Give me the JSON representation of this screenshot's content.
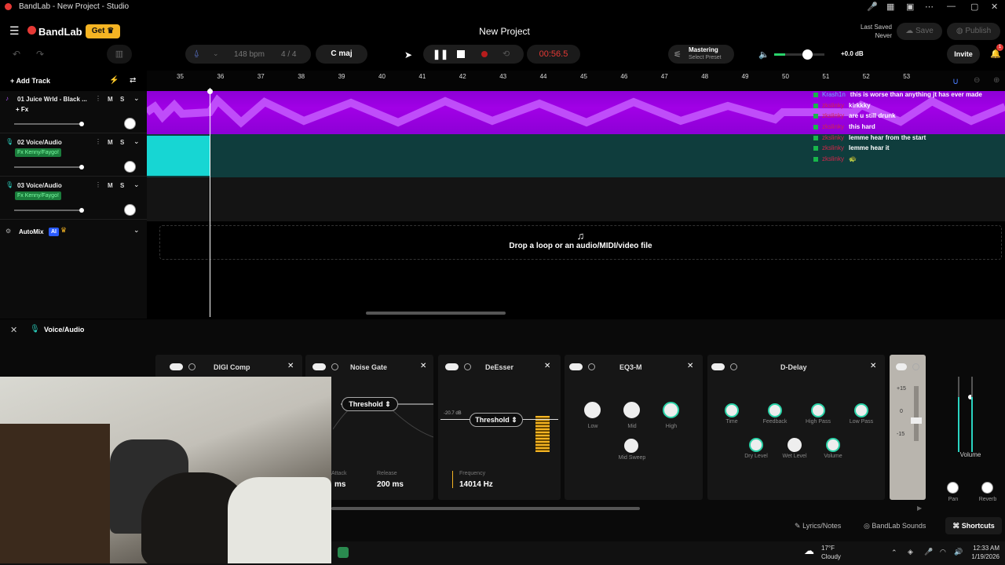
{
  "window": {
    "title": "BandLab - New Project - Studio"
  },
  "header": {
    "brand": "BandLab",
    "get_label": "Get",
    "project_title": "New Project",
    "last_saved_label": "Last Saved",
    "last_saved_value": "Never",
    "save_label": "Save",
    "publish_label": "Publish"
  },
  "toolbar": {
    "bpm_value": "148",
    "bpm_unit": "bpm",
    "time_signature": "4 / 4",
    "key": "C maj",
    "timecode": "00:56.5",
    "mastering_label": "Mastering",
    "mastering_preset": "Select Preset",
    "volume_db": "+0.0 dB",
    "invite_label": "Invite",
    "notification_count": "1"
  },
  "ruler": {
    "labels": [
      "35",
      "36",
      "37",
      "38",
      "39",
      "40",
      "41",
      "42",
      "43",
      "44",
      "45",
      "46",
      "47",
      "48",
      "49",
      "50",
      "51",
      "52",
      "53"
    ]
  },
  "add_track_label": "Add Track",
  "tracks": [
    {
      "name": "01  Juice Wrld - Black ...",
      "fx": "+ Fx",
      "mute": "M",
      "solo": "S"
    },
    {
      "name": "02  Voice/Audio",
      "fx": "Fx Kenny/Faygo!",
      "mute": "M",
      "solo": "S"
    },
    {
      "name": "03  Voice/Audio",
      "fx": "Fx Kenny/Faygo!",
      "mute": "M",
      "solo": "S"
    }
  ],
  "automix": {
    "label": "AutoMix",
    "badge": "AI"
  },
  "dropzone": {
    "text": "Drop a loop or an audio/MIDI/video file"
  },
  "chat": [
    {
      "user": "Krash1n",
      "msg": "this is worse than anything jt has ever made",
      "user_color": "#6fb3ff"
    },
    {
      "user": "zkslinky",
      "msg": "kirkkky",
      "user_color": "#d2264a"
    },
    {
      "user": "zkslinky",
      "msg": "are u still drunk",
      "user_color": "#d2264a"
    },
    {
      "user": "zkslinky",
      "msg": "this hard",
      "user_color": "#d2264a"
    },
    {
      "user": "zkslinky",
      "msg": "lemme hear from the start",
      "user_color": "#d2264a"
    },
    {
      "user": "zkslinky",
      "msg": "lemme hear it",
      "user_color": "#d2264a"
    },
    {
      "user": "zkslinky",
      "msg": "",
      "user_color": "#d2264a"
    }
  ],
  "fx_panel": {
    "track_name": "Voice/Audio",
    "effects": [
      {
        "name": "DIGI Comp"
      },
      {
        "name": "Noise Gate",
        "threshold": "Threshold",
        "attack_label": "Attack",
        "attack_value": "ms",
        "release_label": "Release",
        "release_value": "200 ms"
      },
      {
        "name": "DeEsser",
        "threshold": "Threshold",
        "db": "-20.7 dB",
        "freq_label": "Frequency",
        "freq_value": "14014 Hz"
      },
      {
        "name": "EQ3-M",
        "knobs": [
          "Low",
          "Mid",
          "High",
          "Mid Sweep"
        ]
      },
      {
        "name": "D-Delay",
        "knobs": [
          "Time",
          "Feedback",
          "High Pass",
          "Low Pass",
          "Dry Level",
          "Wet Level",
          "Volume"
        ]
      }
    ],
    "meter_scale": [
      "+15",
      "0",
      "-15"
    ],
    "volume_label": "Volume",
    "pan_label": "Pan",
    "reverb_label": "Reverb"
  },
  "status": {
    "lyrics": "Lyrics/Notes",
    "sounds": "BandLab Sounds",
    "shortcuts": "Shortcuts"
  },
  "taskbar": {
    "temp": "17°F",
    "weather": "Cloudy",
    "time": "12:33 AM",
    "date": "1/19/2026"
  },
  "colors": {
    "accent_red": "#e53935",
    "track1": "#a100e6",
    "track2": "#17d6d3",
    "get_yellow": "#f5b423"
  }
}
